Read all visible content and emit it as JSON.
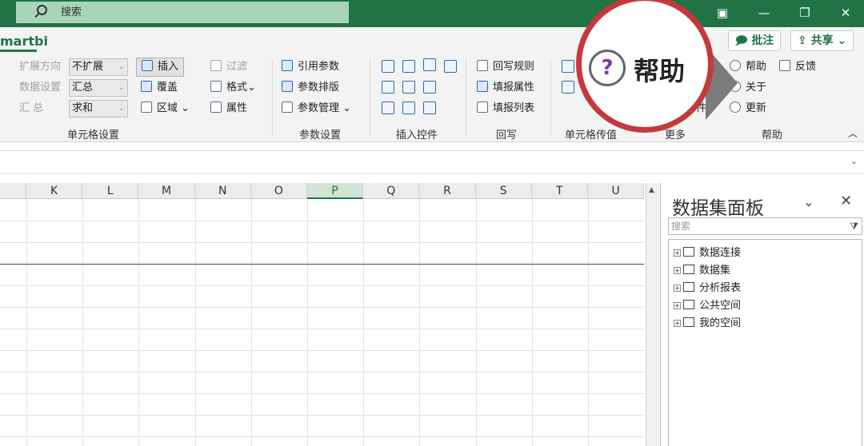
{
  "search": {
    "placeholder": "搜索"
  },
  "window": {
    "ribbon_display": "▣",
    "minimize": "—",
    "restore": "❐",
    "close": "✕"
  },
  "tabs": {
    "active": "martbi"
  },
  "top_buttons": {
    "comment": "批注",
    "share": "共享"
  },
  "ribbon": {
    "cell_settings": {
      "label": "单元格设置",
      "expand_direction": "扩展方向",
      "expand_value": "不扩展",
      "data_settings": "数据设置",
      "data_value": "汇总",
      "summary": "汇    总",
      "summary_value": "求和",
      "insert": "插入",
      "cover": "覆盖",
      "region": "区域",
      "filter": "过滤",
      "format": "格式",
      "attribute": "属性"
    },
    "param_settings": {
      "label": "参数设置",
      "reference": "引用参数",
      "layout": "参数排版",
      "manage": "参数管理"
    },
    "insert_controls": {
      "label": "插入控件"
    },
    "writeback": {
      "label": "回写",
      "rules": "回写规则",
      "attributes": "填报属性",
      "list": "填报列表"
    },
    "cell_pass": {
      "label": "单元格传值"
    },
    "more": {
      "label": "更多",
      "partial": "件"
    },
    "help": {
      "label": "帮助",
      "help": "帮助",
      "feedback": "反馈",
      "about": "关于",
      "update": "更新"
    }
  },
  "callout": {
    "text": "帮助"
  },
  "grid": {
    "columns": [
      "K",
      "L",
      "M",
      "N",
      "O",
      "P",
      "Q",
      "R",
      "S",
      "T",
      "U"
    ],
    "selected_column": "P"
  },
  "panel": {
    "title": "数据集面板",
    "search_placeholder": "搜索",
    "tree": [
      "数据连接",
      "数据集",
      "分析报表",
      "公共空间",
      "我的空间"
    ]
  }
}
